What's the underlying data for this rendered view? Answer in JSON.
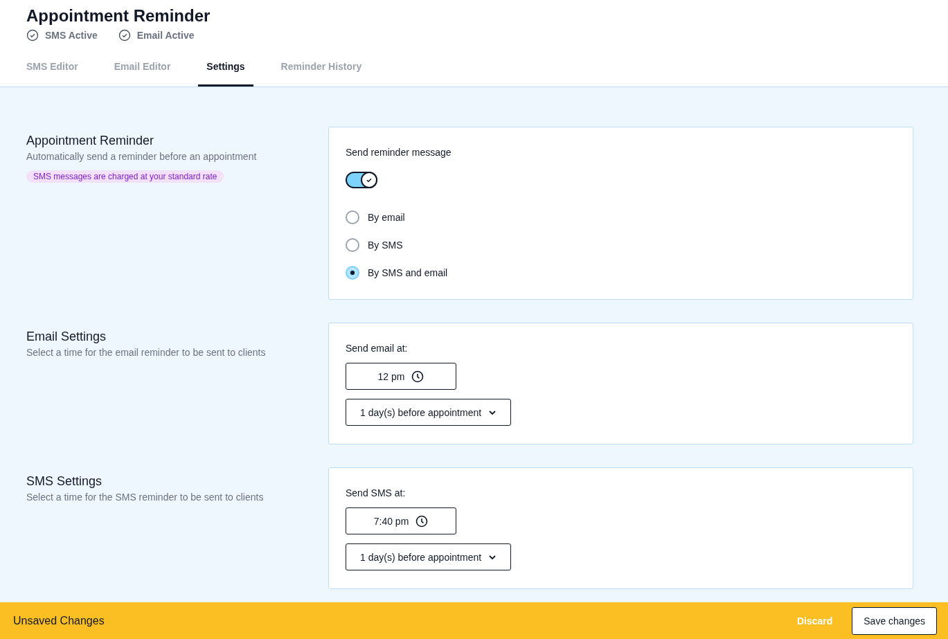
{
  "header": {
    "title": "Appointment Reminder",
    "statuses": [
      {
        "label": "SMS Active"
      },
      {
        "label": "Email Active"
      }
    ]
  },
  "tabs": [
    {
      "label": "SMS Editor",
      "selected": false
    },
    {
      "label": "Email Editor",
      "selected": false
    },
    {
      "label": "Settings",
      "selected": true
    },
    {
      "label": "Reminder History",
      "selected": false
    }
  ],
  "sections": [
    {
      "title": "Appointment Reminder",
      "description": "Automatically send a reminder before an appointment",
      "note": "SMS messages are charged at your standard rate",
      "card": {
        "label": "Send reminder message",
        "controls": [
          {
            "kind": "toggle",
            "on": true
          },
          {
            "kind": "radio",
            "label": "By email",
            "selected": false
          },
          {
            "kind": "radio",
            "label": "By SMS",
            "selected": false
          },
          {
            "kind": "radio",
            "label": "By SMS and email",
            "selected": true
          }
        ]
      }
    },
    {
      "title": "Email Settings",
      "description": "Select a time for the email reminder to be sent to clients",
      "card": {
        "label": "Send email at:",
        "controls": [
          {
            "kind": "time",
            "value": "12 pm"
          },
          {
            "kind": "select",
            "value": "1 day(s) before appointment"
          }
        ]
      }
    },
    {
      "title": "SMS Settings",
      "description": "Select a time for the SMS reminder to be sent to clients",
      "card": {
        "label": "Send SMS at:",
        "controls": [
          {
            "kind": "time",
            "value": "7:40 pm"
          },
          {
            "kind": "select",
            "value": "1 day(s) before appointment"
          }
        ]
      }
    }
  ],
  "footer": {
    "message": "Unsaved Changes",
    "discard": "Discard",
    "save": "Save changes"
  }
}
